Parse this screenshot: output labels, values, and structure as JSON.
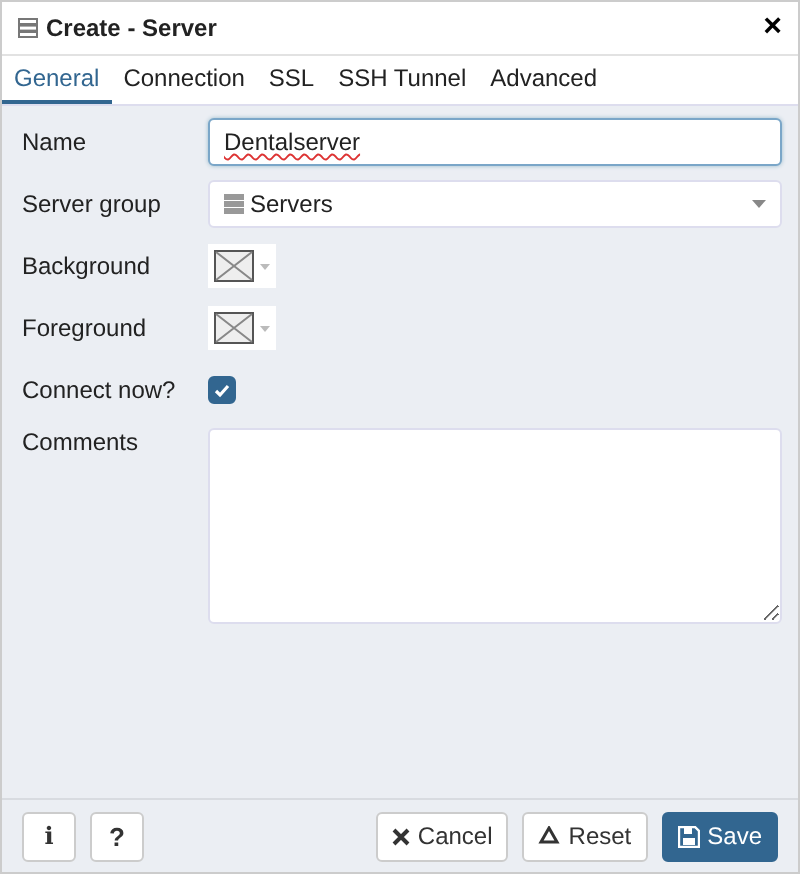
{
  "window": {
    "title": "Create - Server",
    "close": "×"
  },
  "tabs": [
    {
      "label": "General",
      "selected": true
    },
    {
      "label": "Connection",
      "selected": false
    },
    {
      "label": "SSL",
      "selected": false
    },
    {
      "label": "SSH Tunnel",
      "selected": false
    },
    {
      "label": "Advanced",
      "selected": false
    }
  ],
  "fields": [
    {
      "kind": "text",
      "label": "Name",
      "value": "Dentalserver",
      "focused": true
    },
    {
      "kind": "select",
      "label": "Server group",
      "value": "Servers"
    },
    {
      "kind": "color",
      "label": "Background"
    },
    {
      "kind": "color",
      "label": "Foreground"
    },
    {
      "kind": "checkbox",
      "label": "Connect now?",
      "checked": true
    },
    {
      "kind": "textarea",
      "label": "Comments"
    }
  ],
  "footer": {
    "info_button": "i",
    "help_button": "?",
    "buttons": [
      {
        "kind": "cancel",
        "label": "Cancel"
      },
      {
        "kind": "reset",
        "label": "Reset"
      },
      {
        "kind": "save",
        "label": "Save"
      }
    ]
  }
}
